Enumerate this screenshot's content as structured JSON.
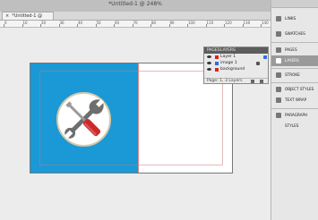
{
  "window": {
    "title": "*Untitled-1 @ 248%"
  },
  "doc_tab": {
    "close_glyph": "×",
    "label": "*Untitled-1 @ 248%"
  },
  "ruler": {
    "labels": [
      "0",
      "10",
      "20",
      "30",
      "40",
      "50",
      "60",
      "70",
      "80",
      "90",
      "100",
      "110",
      "120",
      "130",
      "140"
    ]
  },
  "layers_panel": {
    "tabs": [
      "PAGES",
      "LAYERS"
    ],
    "layers": [
      {
        "name": "Layer 1",
        "color": "#e02020"
      },
      {
        "name": "image 1",
        "color": "#2e6be6"
      },
      {
        "name": "background",
        "color": "#e02020"
      }
    ],
    "footer": "Page: 1, 3 Layers"
  },
  "dock": {
    "items": [
      {
        "label": "LINKS",
        "icon": "links-icon"
      },
      {
        "label": "SWATCHES",
        "icon": "swatches-icon"
      },
      {
        "label": "PAGES",
        "icon": "pages-icon"
      },
      {
        "label": "LAYERS",
        "icon": "layers-icon",
        "active": true
      },
      {
        "label": "STROKE",
        "icon": "stroke-icon"
      },
      {
        "label": "OBJECT STYLES",
        "icon": "object-styles-icon"
      },
      {
        "label": "TEXT WRAP",
        "icon": "text-wrap-icon"
      },
      {
        "label": "PARAGRAPH STYLES",
        "icon": "paragraph-styles-icon"
      }
    ]
  },
  "colors": {
    "accent": "#1a99d6",
    "handle": "#cc2a2a",
    "dock_active": "#9a9a9a"
  }
}
